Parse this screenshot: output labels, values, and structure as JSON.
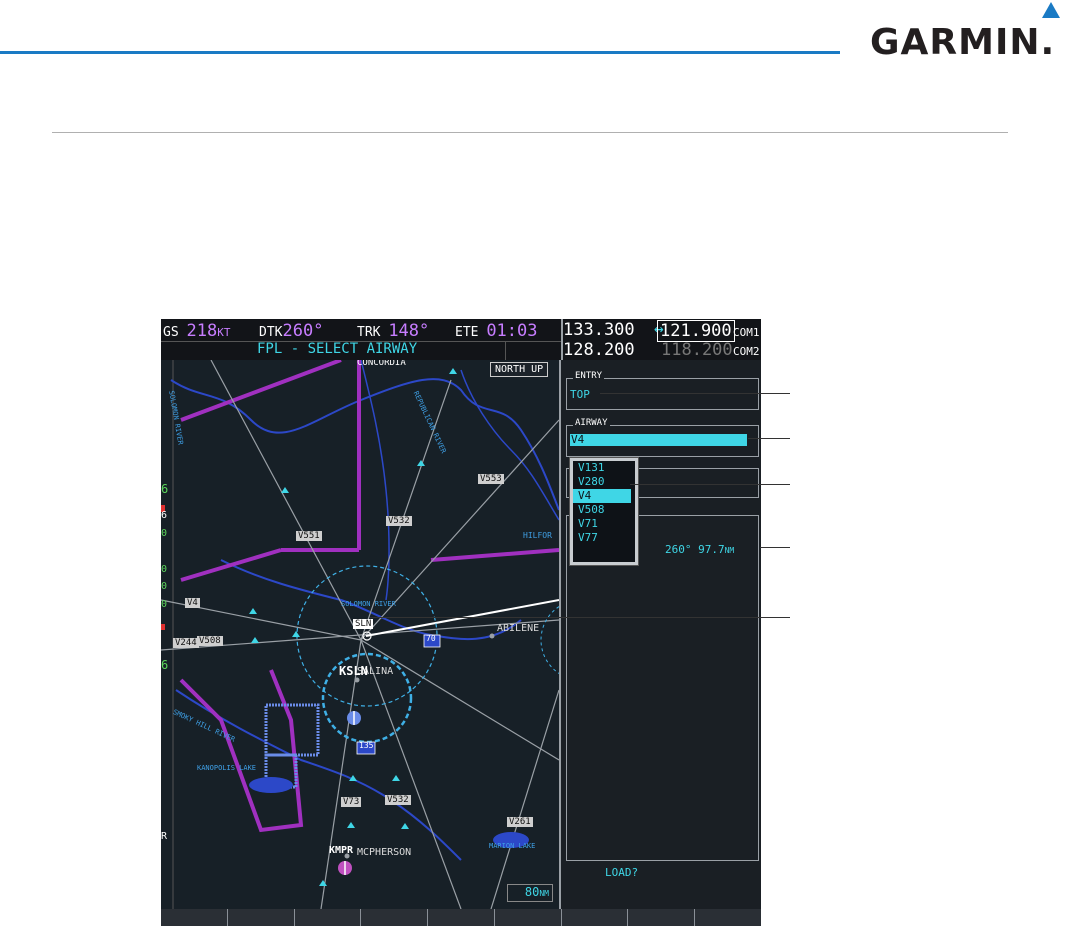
{
  "brand": {
    "logo_text": "GARMIN.",
    "accent_color": "#1a7ac4"
  },
  "databar": {
    "gs_label": "GS",
    "gs_value": "218",
    "gs_unit": "KT",
    "dtk_label": "DTK",
    "dtk_value": "260°",
    "trk_label": "TRK",
    "trk_value": "148°",
    "ete_label": "ETE",
    "ete_value": "01:03",
    "page_title": "FPL - SELECT AIRWAY"
  },
  "com": {
    "com1_standby": "133.300",
    "com1_active": "121.900",
    "com1_label": "COM1",
    "com2_standby": "128.200",
    "com2_active": "118.200",
    "com2_label": "COM2",
    "transfer_icon": "swap-arrow-icon"
  },
  "map": {
    "orientation": "NORTH UP",
    "range": "80",
    "range_unit": "NM",
    "labels": {
      "concordia": "CONCORDIA",
      "salina": "SALINA",
      "abilene": "ABILENE",
      "mcpherson": "MCPHERSON",
      "solomon_river": "SOLOMON RIVER",
      "kanopolis_lake": "KANOPOLIS LAKE",
      "smoky_hill": "SMOKY HILL RIVER",
      "marion_lake": "MARION LAKE",
      "republican": "REPUBLICAN RIVER",
      "hilford": "HILFOR",
      "salomon_west": "SOLOMON RIVER"
    },
    "airports": {
      "ksln": "KSLN",
      "kmpr": "KMPR"
    },
    "vor": "SLN",
    "airways": [
      "V4",
      "V508",
      "V244",
      "V551",
      "V532",
      "V553",
      "V73",
      "V261"
    ],
    "interstates": [
      "70",
      "135"
    ],
    "side_digits": [
      "6",
      "6",
      "0",
      "0",
      "0",
      "0",
      "6",
      "R"
    ]
  },
  "panel": {
    "entry_title": "ENTRY",
    "entry_value": "TOP",
    "airway_title": "AIRWAY",
    "airway_value": "V4",
    "distance_text": "260°  97.7",
    "distance_unit": "NM",
    "load_prompt": "LOAD?"
  },
  "airway_list": [
    "V131",
    "V280",
    "V4",
    "V508",
    "V71",
    "V77"
  ],
  "airway_selected": "V4",
  "softkey_count": 9
}
